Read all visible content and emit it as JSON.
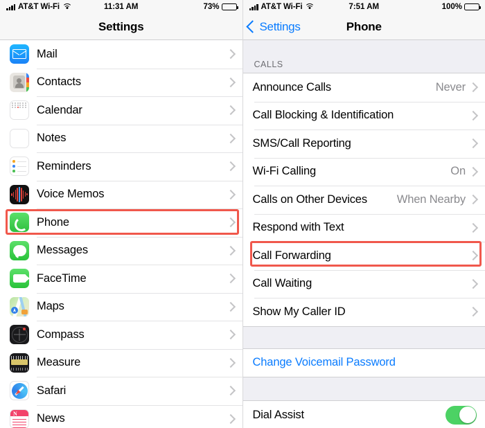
{
  "left": {
    "status": {
      "carrier": "AT&T Wi-Fi",
      "time": "11:31 AM",
      "battery": "73%",
      "signal_icon": "cellular-signal-icon",
      "wifi_icon": "wifi-icon",
      "battery_icon": "battery-icon"
    },
    "nav": {
      "title": "Settings"
    },
    "items": [
      {
        "label": "Mail",
        "icon": "mail-app-icon"
      },
      {
        "label": "Contacts",
        "icon": "contacts-app-icon"
      },
      {
        "label": "Calendar",
        "icon": "calendar-app-icon"
      },
      {
        "label": "Notes",
        "icon": "notes-app-icon"
      },
      {
        "label": "Reminders",
        "icon": "reminders-app-icon"
      },
      {
        "label": "Voice Memos",
        "icon": "voice-memos-app-icon"
      },
      {
        "label": "Phone",
        "icon": "phone-app-icon"
      },
      {
        "label": "Messages",
        "icon": "messages-app-icon"
      },
      {
        "label": "FaceTime",
        "icon": "facetime-app-icon"
      },
      {
        "label": "Maps",
        "icon": "maps-app-icon"
      },
      {
        "label": "Compass",
        "icon": "compass-app-icon"
      },
      {
        "label": "Measure",
        "icon": "measure-app-icon"
      },
      {
        "label": "Safari",
        "icon": "safari-app-icon"
      },
      {
        "label": "News",
        "icon": "news-app-icon"
      }
    ]
  },
  "right": {
    "status": {
      "carrier": "AT&T Wi-Fi",
      "time": "7:51 AM",
      "battery": "100%",
      "signal_icon": "cellular-signal-icon",
      "wifi_icon": "wifi-icon",
      "battery_icon": "battery-icon"
    },
    "nav": {
      "back_label": "Settings",
      "title": "Phone",
      "back_icon": "chevron-left-icon"
    },
    "section_header": "CALLS",
    "items": [
      {
        "label": "Announce Calls",
        "value": "Never"
      },
      {
        "label": "Call Blocking & Identification",
        "value": ""
      },
      {
        "label": "SMS/Call Reporting",
        "value": ""
      },
      {
        "label": "Wi-Fi Calling",
        "value": "On"
      },
      {
        "label": "Calls on Other Devices",
        "value": "When Nearby"
      },
      {
        "label": "Respond with Text",
        "value": ""
      },
      {
        "label": "Call Forwarding",
        "value": ""
      },
      {
        "label": "Call Waiting",
        "value": ""
      },
      {
        "label": "Show My Caller ID",
        "value": ""
      }
    ],
    "voicemail_link": "Change Voicemail Password",
    "dial_assist": {
      "label": "Dial Assist",
      "state": "on"
    }
  },
  "highlights": {
    "color": "#f0584c",
    "targets": [
      "Phone",
      "Call Forwarding"
    ]
  }
}
